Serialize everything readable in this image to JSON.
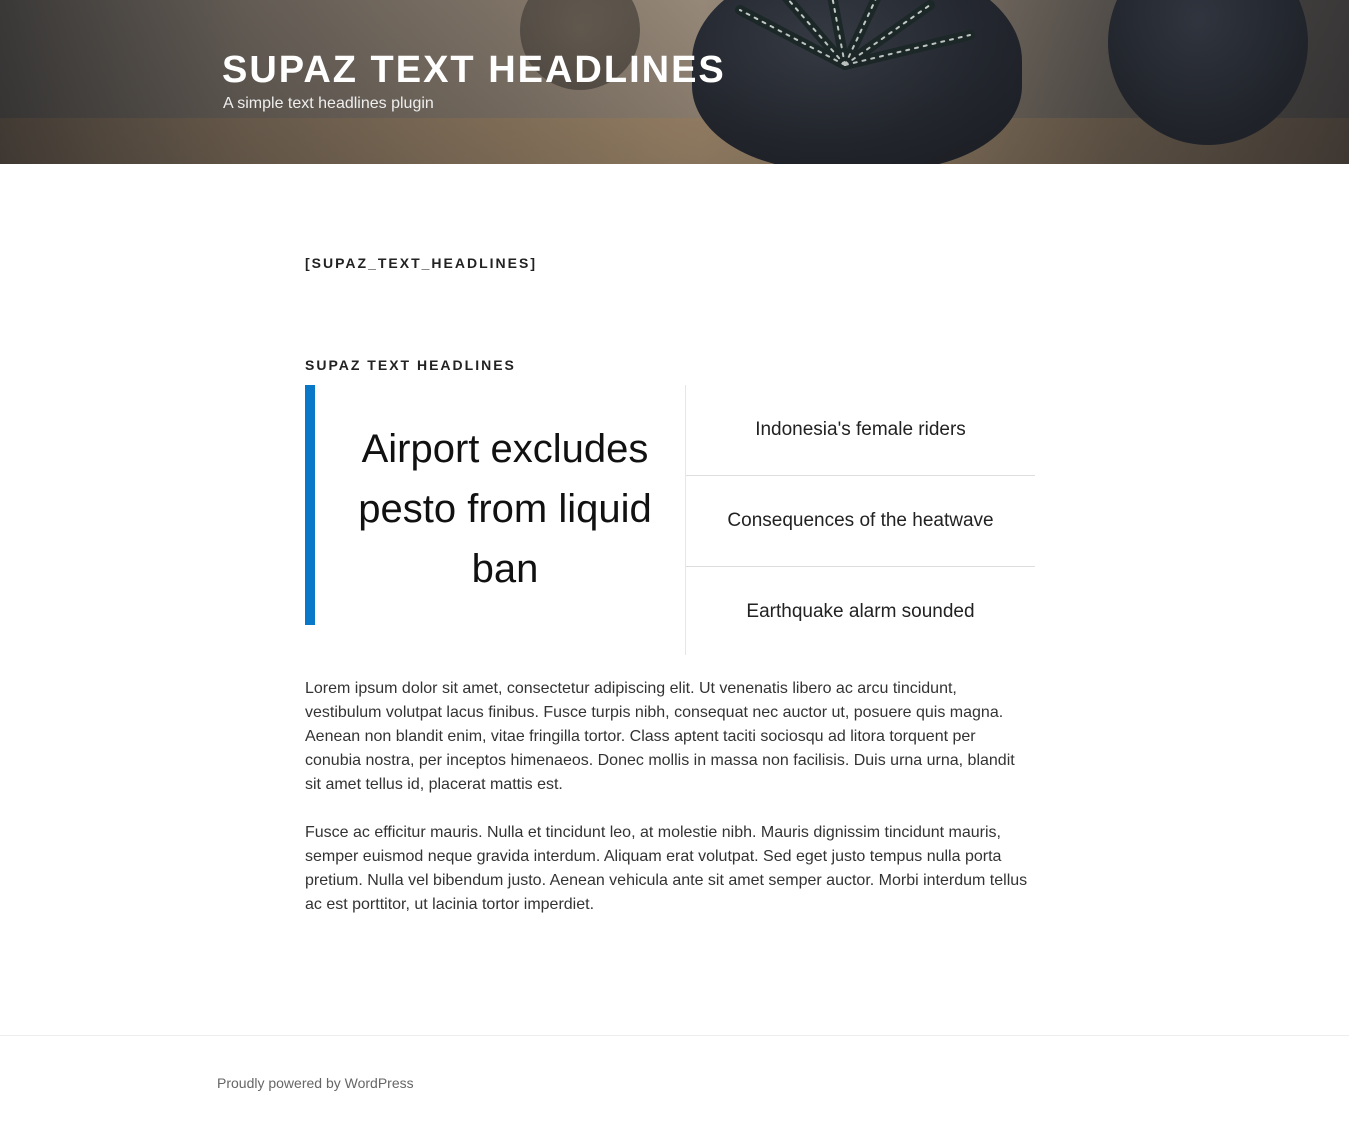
{
  "header": {
    "site_title": "SUPAZ TEXT HEADLINES",
    "site_description": "A simple text headlines plugin"
  },
  "page": {
    "title": "[SUPAZ_TEXT_HEADLINES]"
  },
  "widget": {
    "title": "SUPAZ TEXT HEADLINES",
    "accent_color": "#0a78c8",
    "featured_headline": "Airport excludes pesto from liquid ban",
    "headlines": [
      "Indonesia's female riders",
      "Consequences of the heatwave",
      "Earthquake alarm sounded"
    ]
  },
  "content": {
    "paragraphs": [
      "Lorem ipsum dolor sit amet, consectetur adipiscing elit. Ut venenatis libero ac arcu tincidunt, vestibulum volutpat lacus finibus. Fusce turpis nibh, consequat nec auctor ut, posuere quis magna. Aenean non blandit enim, vitae fringilla tortor. Class aptent taciti sociosqu ad litora torquent per conubia nostra, per inceptos himenaeos. Donec mollis in massa non facilisis. Duis urna urna, blandit sit amet tellus id, placerat mattis est.",
      "Fusce ac efficitur mauris. Nulla et tincidunt leo, at molestie nibh. Mauris dignissim tincidunt mauris, semper euismod neque gravida interdum. Aliquam erat volutpat. Sed eget justo tempus nulla porta pretium. Nulla vel bibendum justo. Aenean vehicula ante sit amet semper auctor. Morbi interdum tellus ac est porttitor, ut lacinia tortor imperdiet."
    ]
  },
  "footer": {
    "credit": "Proudly powered by WordPress"
  }
}
